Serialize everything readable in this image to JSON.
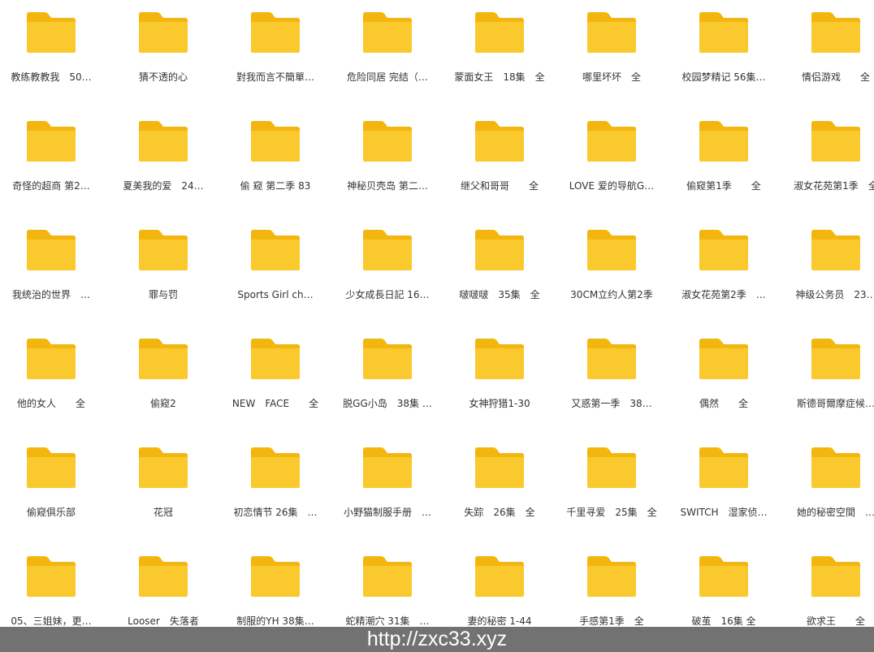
{
  "colors": {
    "folder_back": "#F2B60F",
    "folder_front": "#FAC92E",
    "label_text": "#333333",
    "watermark_bar": "#727272",
    "watermark_text": "#FFFFFF"
  },
  "icon": "folder-icon",
  "folders": [
    [
      "教练教教我　50…",
      "猜不透的心",
      "對我而言不簡單…",
      "危险同居 完结（…",
      "蒙面女王　18集　全",
      "哪里坏坏　全",
      "校园梦精记 56集…",
      "情侣游戏　　全"
    ],
    [
      "奇怪的超商 第2…",
      "夏美我的爱　24…",
      "偷 窥 第二季 83",
      "神秘贝壳岛 第二…",
      "继父和哥哥　　全",
      "LOVE 爱的导航G…",
      "偷窥第1季　　全",
      "淑女花苑第1季　全"
    ],
    [
      "我统治的世界　…",
      "罪与罚",
      "Sports Girl ch…",
      "少女成長日記 16…",
      "啵啵啵　35集　全",
      "30CM立约人第2季",
      "淑女花苑第2季　…",
      "神级公务员　23…"
    ],
    [
      "他的女人　　全",
      "偷窥2",
      "NEW　FACE　　全",
      "脱GG小岛　38集 …",
      "女神狩猎1-30",
      "又惑第一季　38…",
      "偶然　　全",
      "斯德哥爾摩症候…"
    ],
    [
      "偷窥俱乐部",
      "花冠",
      "初恋情节 26集　…",
      "小野猫制服手册　…",
      "失踪　26集　全",
      "千里寻爱　25集　全",
      "SWITCH　湿家侦…",
      "她的秘密空間　…"
    ],
    [
      "05、三姐妹，更…",
      "Looser　失落者",
      "制服的YH 38集…",
      "蛇精潮穴 31集　…",
      "妻的秘密 1-44",
      "手感第1季　全",
      "破茧　16集 全",
      "欲求王　　全"
    ]
  ],
  "watermark": {
    "url": "http://zxc33.xyz"
  }
}
